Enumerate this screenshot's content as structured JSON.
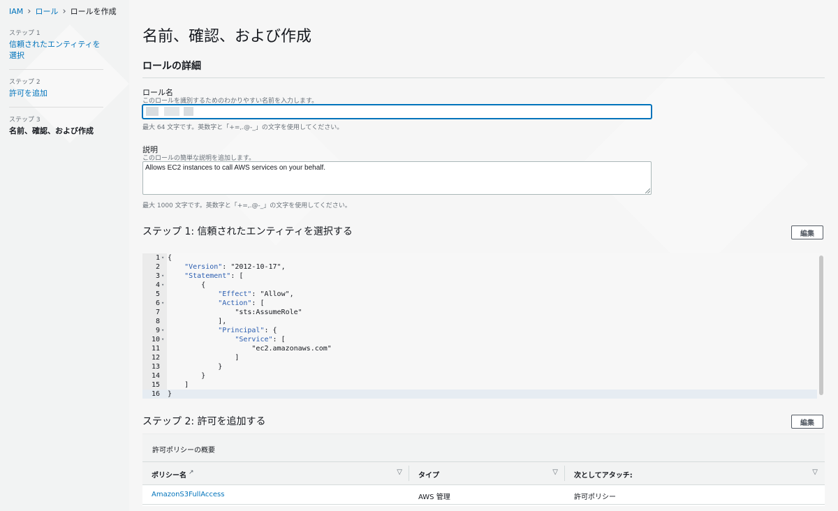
{
  "breadcrumb": {
    "items": [
      "IAM",
      "ロール"
    ],
    "current": "ロールを作成"
  },
  "steps": [
    {
      "num": "ステップ 1",
      "title": "信頼されたエンティティを選択"
    },
    {
      "num": "ステップ 2",
      "title": "許可を追加"
    },
    {
      "num": "ステップ 3",
      "title": "名前、確認、および作成"
    }
  ],
  "page_title": "名前、確認、および作成",
  "details": {
    "heading": "ロールの詳細",
    "role_name_label": "ロール名",
    "role_name_desc": "このロールを識別するためのわかりやすい名前を入力します。",
    "role_name_value": "",
    "role_name_hint": "最大 64 文字です。英数字と「+=,.@-_」の文字を使用してください。",
    "desc_label": "説明",
    "desc_desc": "このロールの簡単な説明を追加します。",
    "desc_value": "Allows EC2 instances to call AWS services on your behalf.",
    "desc_hint": "最大 1000 文字です。英数字と「+=,.@-_」の文字を使用してください。"
  },
  "step1": {
    "heading": "ステップ 1: 信頼されたエンティティを選択する",
    "edit_label": "編集"
  },
  "code_lines": [
    {
      "n": "1",
      "fold": true,
      "text": "{"
    },
    {
      "n": "2",
      "fold": false,
      "text": "    \"Version\": \"2012-10-17\","
    },
    {
      "n": "3",
      "fold": true,
      "text": "    \"Statement\": ["
    },
    {
      "n": "4",
      "fold": true,
      "text": "        {"
    },
    {
      "n": "5",
      "fold": false,
      "text": "            \"Effect\": \"Allow\","
    },
    {
      "n": "6",
      "fold": true,
      "text": "            \"Action\": ["
    },
    {
      "n": "7",
      "fold": false,
      "text": "                \"sts:AssumeRole\""
    },
    {
      "n": "8",
      "fold": false,
      "text": "            ],"
    },
    {
      "n": "9",
      "fold": true,
      "text": "            \"Principal\": {"
    },
    {
      "n": "10",
      "fold": true,
      "text": "                \"Service\": ["
    },
    {
      "n": "11",
      "fold": false,
      "text": "                    \"ec2.amazonaws.com\""
    },
    {
      "n": "12",
      "fold": false,
      "text": "                ]"
    },
    {
      "n": "13",
      "fold": false,
      "text": "            }"
    },
    {
      "n": "14",
      "fold": false,
      "text": "        }"
    },
    {
      "n": "15",
      "fold": false,
      "text": "    ]"
    },
    {
      "n": "16",
      "fold": false,
      "text": "}"
    }
  ],
  "step2": {
    "heading": "ステップ 2: 許可を追加する",
    "edit_label": "編集",
    "summary_title": "許可ポリシーの概要",
    "columns": [
      "ポリシー名",
      "タイプ",
      "次としてアタッチ:"
    ],
    "rows": [
      {
        "policy": "AmazonS3FullAccess",
        "type": "AWS 管理",
        "attached_as": "許可ポリシー"
      }
    ]
  }
}
